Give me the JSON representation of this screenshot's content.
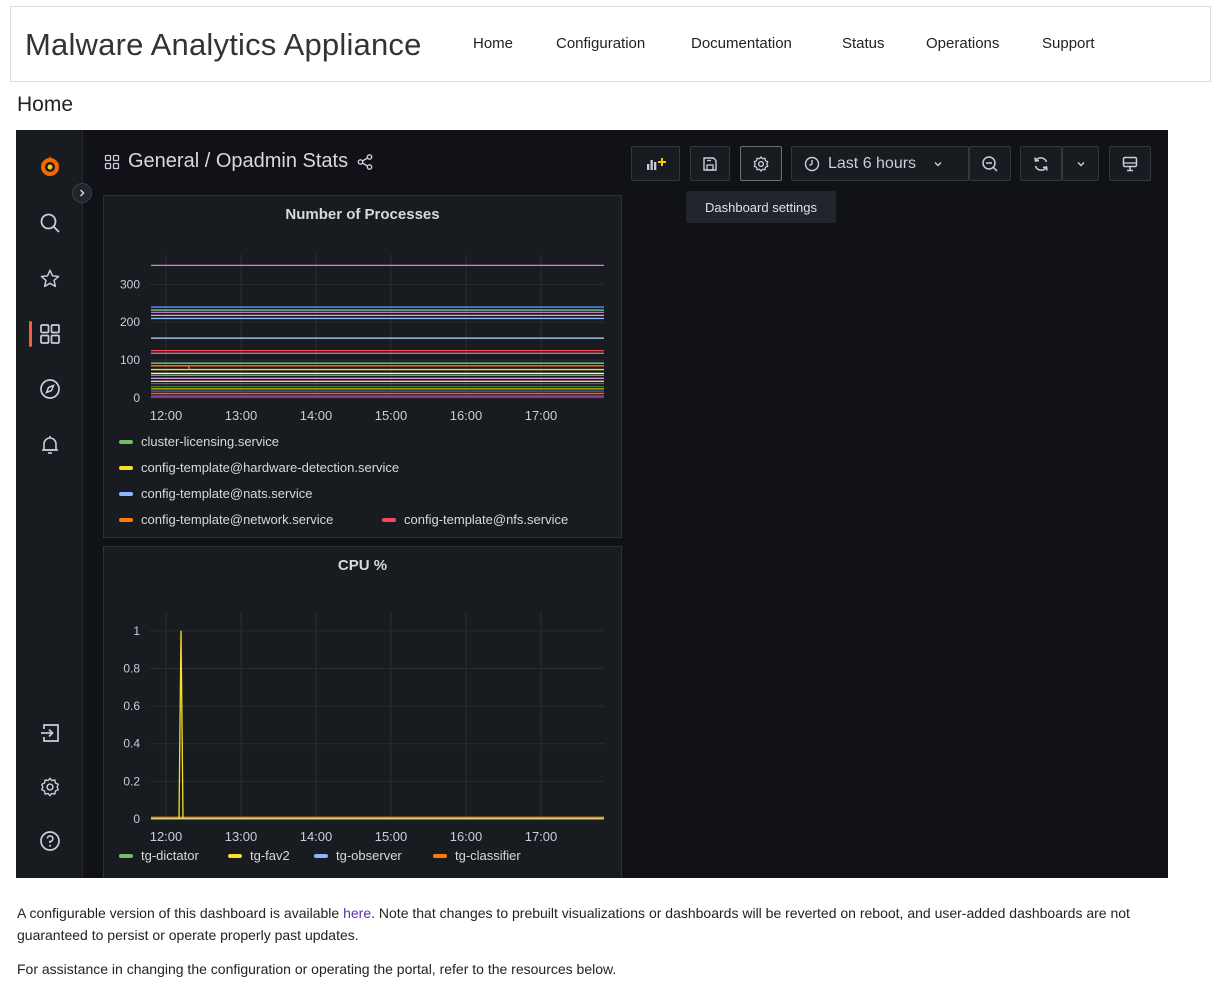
{
  "header": {
    "app_title": "Malware Analytics Appliance",
    "nav": [
      "Home",
      "Configuration",
      "Documentation",
      "Status",
      "Operations",
      "Support"
    ]
  },
  "page": {
    "heading": "Home"
  },
  "grafana": {
    "sidenav_icons": [
      "grafana-logo-icon",
      "search-icon",
      "star-icon",
      "dashboards-icon",
      "explore-icon",
      "alert-bell-icon",
      "sign-in-icon",
      "gear-icon",
      "help-icon"
    ],
    "dashboard_title": "General / Opadmin Stats",
    "time_range": "Last 6 hours",
    "tooltip": "Dashboard settings",
    "accent_color": "#f55f3e"
  },
  "panels": [
    {
      "title": "Number of Processes",
      "legend": [
        {
          "label": "cluster-licensing.service",
          "color": "#73bf69"
        },
        {
          "label": "config-template@hardware-detection.service",
          "color": "#fade2a"
        },
        {
          "label": "config-template@nats.service",
          "color": "#8ab8ff"
        },
        {
          "label": "config-template@network.service",
          "color": "#ff780a"
        },
        {
          "label": "config-template@nfs.service",
          "color": "#f2495c"
        }
      ]
    },
    {
      "title": "CPU %",
      "legend": [
        {
          "label": "tg-dictator",
          "color": "#73bf69"
        },
        {
          "label": "tg-fav2",
          "color": "#fade2a"
        },
        {
          "label": "tg-observer",
          "color": "#8ab8ff"
        },
        {
          "label": "tg-classifier",
          "color": "#ff780a"
        }
      ]
    }
  ],
  "chart_data": [
    {
      "type": "line",
      "title": "Number of Processes",
      "x_ticks": [
        "12:00",
        "13:00",
        "14:00",
        "15:00",
        "16:00",
        "17:00"
      ],
      "y_ticks": [
        0,
        100,
        200,
        300
      ],
      "ylim": [
        0,
        380
      ],
      "series": [
        {
          "name": "cluster-licensing.service",
          "color": "#73bf69",
          "values": [
            60,
            60
          ]
        },
        {
          "name": "config-template@hardware-detection.service",
          "color": "#fade2a",
          "values": [
            75,
            75
          ]
        },
        {
          "name": "config-template@nats.service",
          "color": "#8ab8ff",
          "values": [
            210,
            210
          ]
        },
        {
          "name": "config-template@network.service",
          "color": "#ff780a",
          "values": [
            85,
            85
          ]
        },
        {
          "name": "config-template@nfs.service",
          "color": "#f2495c",
          "values": [
            125,
            125
          ]
        }
      ],
      "other_levels": [
        {
          "color": "#d683ce",
          "value": 350
        },
        {
          "color": "#5794f2",
          "value": 240
        },
        {
          "color": "#6ccf8e",
          "value": 232
        },
        {
          "color": "#b877d9",
          "value": 226
        },
        {
          "color": "#ffb357",
          "value": 218
        },
        {
          "color": "#c0d8ff",
          "value": 158
        },
        {
          "color": "#ff7383",
          "value": 118
        },
        {
          "color": "#96d98d",
          "value": 92
        },
        {
          "color": "#fff899",
          "value": 65
        },
        {
          "color": "#ca95e5",
          "value": 52
        },
        {
          "color": "#ffcb7d",
          "value": 44
        },
        {
          "color": "#8f3bb8",
          "value": 38
        },
        {
          "color": "#37872d",
          "value": 30
        },
        {
          "color": "#e0b400",
          "value": 24
        },
        {
          "color": "#1f60c4",
          "value": 18
        },
        {
          "color": "#fa6400",
          "value": 12
        },
        {
          "color": "#c4162a",
          "value": 7
        },
        {
          "color": "#a352cc",
          "value": 3
        }
      ]
    },
    {
      "type": "line",
      "title": "CPU %",
      "x_ticks": [
        "12:00",
        "13:00",
        "14:00",
        "15:00",
        "16:00",
        "17:00"
      ],
      "y_ticks": [
        0,
        0.2,
        0.4,
        0.6,
        0.8,
        1
      ],
      "ylim": [
        0,
        1.1
      ],
      "series": [
        {
          "name": "tg-dictator",
          "color": "#73bf69",
          "values": [
            0,
            0
          ]
        },
        {
          "name": "tg-fav2",
          "color": "#fade2a",
          "spike_values": [
            0,
            1,
            0
          ]
        },
        {
          "name": "tg-observer",
          "color": "#8ab8ff",
          "values": [
            0,
            0
          ]
        },
        {
          "name": "tg-classifier",
          "color": "#ff780a",
          "values": [
            0,
            0
          ]
        }
      ]
    }
  ],
  "footer": {
    "text1_before": "A configurable version of this dashboard is available ",
    "text1_link": "here",
    "text1_after": ". Note that changes to prebuilt visualizations or dashboards will be reverted on reboot, and user-added dashboards are not guaranteed to persist or operate properly past updates.",
    "text2": "For assistance in changing the configuration or operating the portal, refer to the resources below."
  }
}
